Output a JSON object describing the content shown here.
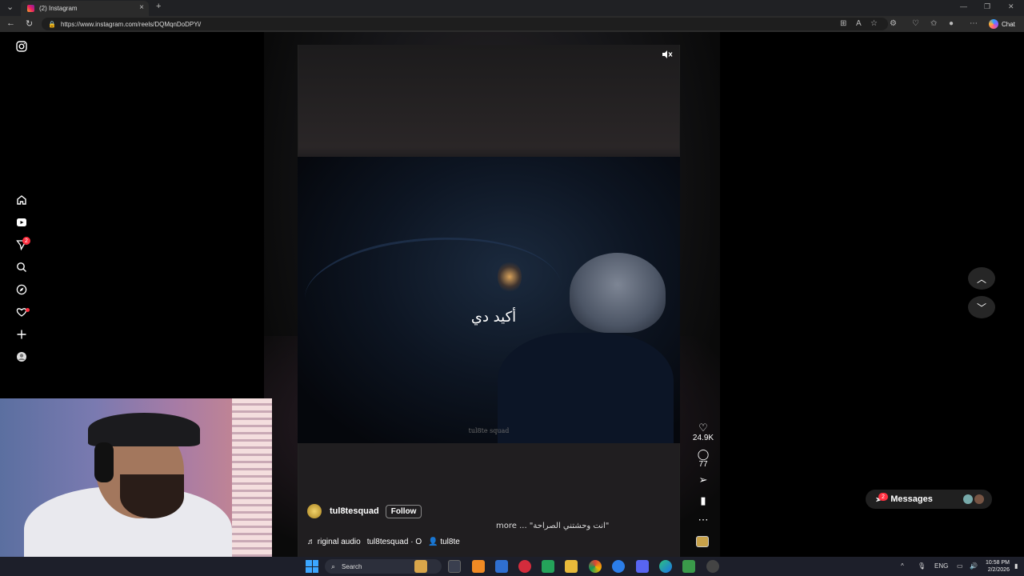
{
  "browser": {
    "tab_title": "(2) Instagram",
    "url": "https://www.instagram.com/reels/DQMqnDoDPYi/",
    "chat_label": "Chat"
  },
  "reel": {
    "subtitle": "أكيد دي",
    "watermark": "tul8te squad",
    "likes": "24.9K",
    "comments": "77",
    "username": "tul8tesquad",
    "follow_label": "Follow",
    "caption": "more ... \"انت وحشتني الصراحة\"",
    "audio_label": "riginal audio",
    "audio_user": "tul8tesquad · O",
    "tagged_user": "tul8te"
  },
  "sidebar": {
    "notification_badge": "2"
  },
  "messages": {
    "label": "Messages",
    "badge": "2"
  },
  "taskbar": {
    "search_placeholder": "Search",
    "language": "ENG",
    "time": "10:58 PM",
    "date": "2/2/2026"
  },
  "icons": {
    "instagram": "instagram-logo-icon",
    "home": "home-icon",
    "reels": "reels-icon",
    "messages": "direct-icon",
    "search": "search-icon",
    "explore": "explore-icon",
    "notifications": "heart-icon",
    "create": "plus-icon",
    "profile": "profile-icon"
  },
  "colors": {
    "badge": "#ff3040",
    "background": "#000000"
  }
}
